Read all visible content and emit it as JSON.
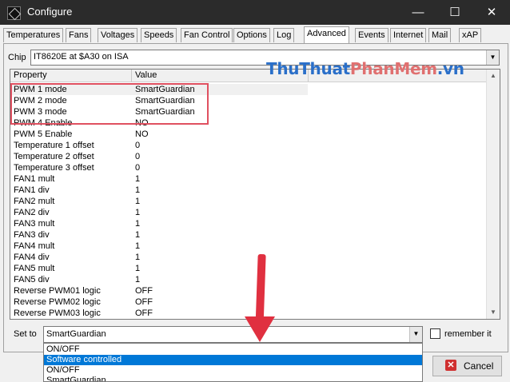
{
  "window": {
    "title": "Configure",
    "minimize": "—",
    "maximize": "☐",
    "close": "✕"
  },
  "tabs": [
    {
      "label": "Temperatures"
    },
    {
      "label": "Fans"
    },
    {
      "label": "Voltages"
    },
    {
      "label": "Speeds"
    },
    {
      "label": "Fan Control"
    },
    {
      "label": "Options"
    },
    {
      "label": "Log"
    },
    {
      "label": "Advanced",
      "active": true
    },
    {
      "label": "Events"
    },
    {
      "label": "Internet"
    },
    {
      "label": "Mail"
    },
    {
      "label": "xAP"
    }
  ],
  "chip": {
    "label": "Chip",
    "value": "IT8620E at $A30 on ISA"
  },
  "table": {
    "headers": [
      "Property",
      "Value"
    ],
    "rows": [
      [
        "PWM 1 mode",
        "SmartGuardian"
      ],
      [
        "PWM 2 mode",
        "SmartGuardian"
      ],
      [
        "PWM 3 mode",
        "SmartGuardian"
      ],
      [
        "PWM 4 Enable",
        "NO"
      ],
      [
        "PWM 5 Enable",
        "NO"
      ],
      [
        "Temperature 1 offset",
        "0"
      ],
      [
        "Temperature 2 offset",
        "0"
      ],
      [
        "Temperature 3 offset",
        "0"
      ],
      [
        "FAN1 mult",
        "1"
      ],
      [
        "FAN1 div",
        "1"
      ],
      [
        "FAN2 mult",
        "1"
      ],
      [
        "FAN2 div",
        "1"
      ],
      [
        "FAN3 mult",
        "1"
      ],
      [
        "FAN3 div",
        "1"
      ],
      [
        "FAN4 mult",
        "1"
      ],
      [
        "FAN4 div",
        "1"
      ],
      [
        "FAN5 mult",
        "1"
      ],
      [
        "FAN5 div",
        "1"
      ],
      [
        "Reverse PWM01 logic",
        "OFF"
      ],
      [
        "Reverse PWM02 logic",
        "OFF"
      ],
      [
        "Reverse PWM03 logic",
        "OFF"
      ]
    ]
  },
  "setto": {
    "label": "Set to",
    "value": "SmartGuardian"
  },
  "remember": {
    "label": "remember it"
  },
  "dropdown_options": [
    "ON/OFF",
    "Software controlled",
    "ON/OFF",
    "SmartGuardian"
  ],
  "cancel": {
    "label": "Cancel"
  },
  "watermark": {
    "part1": "ThuThuat",
    "part2": "PhanMem",
    "part3": ".vn"
  },
  "colors": {
    "titlebar": "#2b2b2b",
    "selection": "#0078d7",
    "annotation": "#e03040"
  }
}
